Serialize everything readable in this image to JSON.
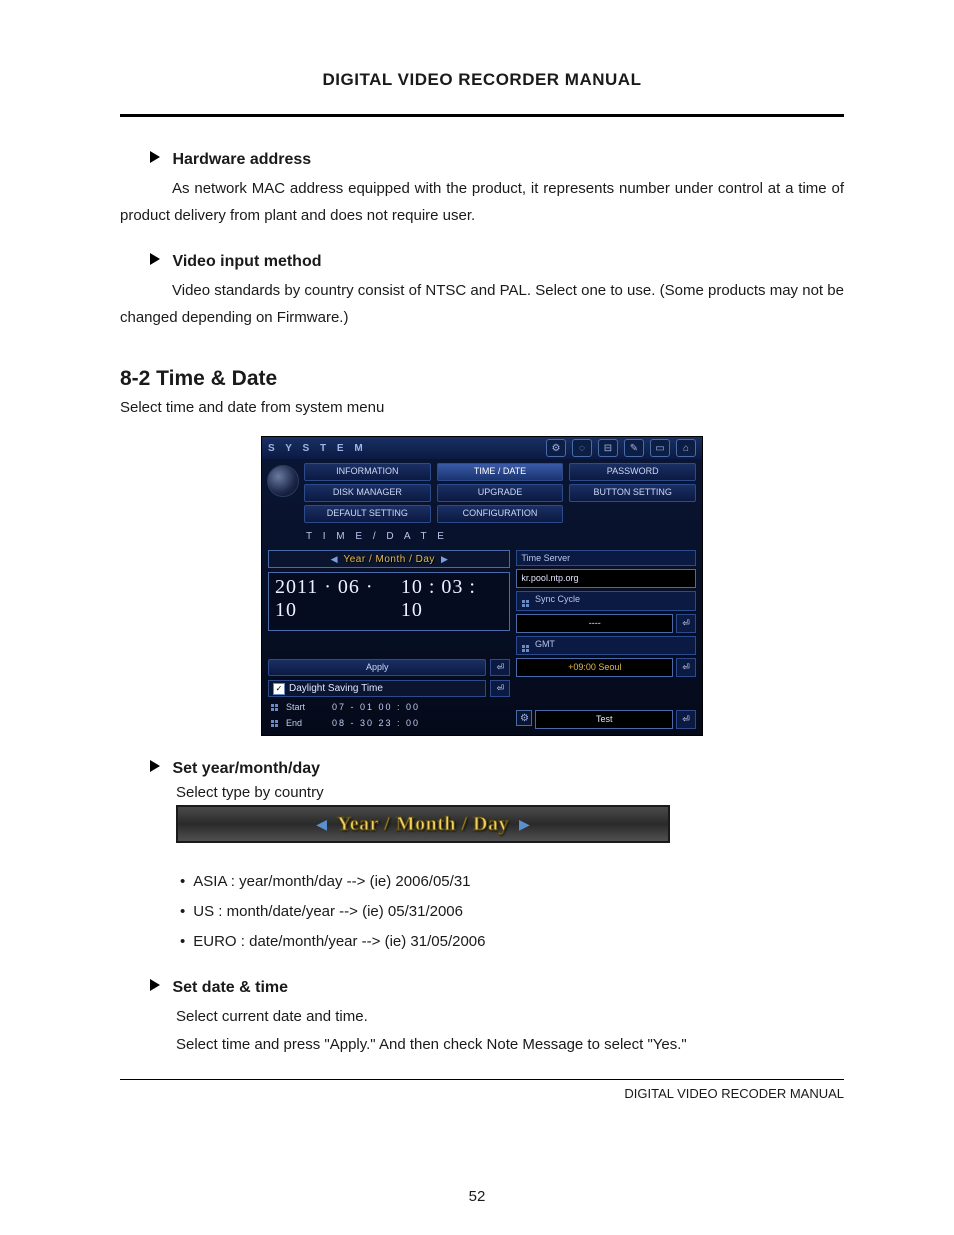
{
  "header_title": "DIGITAL VIDEO RECORDER MANUAL",
  "h_hw": "Hardware address",
  "p_hw": "As network MAC address equipped with the product, it represents number under control at a time of product delivery from plant and does not require user.",
  "h_vim": "Video input method",
  "p_vim": "Video standards by country consist of NTSC and PAL. Select one to use.  (Some products may not be changed depending on Firmware.)",
  "sec_td": "8-2 Time & Date",
  "sec_td_sub": "Select time and date from system menu",
  "dvr": {
    "title": "S Y S T E M",
    "tabs": {
      "r1": [
        "INFORMATION",
        "TIME / DATE",
        "PASSWORD"
      ],
      "r2": [
        "DISK MANAGER",
        "UPGRADE",
        "BUTTON SETTING"
      ],
      "r3": [
        "DEFAULT SETTING",
        "CONFIGURATION",
        ""
      ]
    },
    "section": "T I M E   /   D A T E",
    "ymd_label": "Year / Month / Day",
    "date": "2011 · 06 · 10",
    "time": "10 : 03 : 10",
    "apply": "Apply",
    "dst": "Daylight Saving Time",
    "start_label": "Start",
    "start_vals": "07   -   01        00   :   00",
    "end_label": "End",
    "end_vals": "08   -   30        23   :   00",
    "ts_head": "Time Server",
    "ts_val": "kr.pool.ntp.org",
    "sync_head": "Sync Cycle",
    "sync_val": "----",
    "gmt_head": "GMT",
    "gmt_val": "+09:00 Seoul",
    "test": "Test"
  },
  "h_ymd": "Set year/month/day",
  "p_ymd": "Select type by country",
  "ymd_big": "Year / Month / Day",
  "li_asia": "ASIA   : year/month/day --> (ie) 2006/05/31",
  "li_us": "US      : month/date/year --> (ie) 05/31/2006",
  "li_euro": "EURO : date/month/year --> (ie) 31/05/2006",
  "h_dt": "Set date & time",
  "p_dt1": "Select current date and time.",
  "p_dt2": "Select time and press \"Apply.\" And then check Note Message to select \"Yes.\"",
  "footer": "DIGITAL VIDEO RECODER MANUAL",
  "page": "52"
}
